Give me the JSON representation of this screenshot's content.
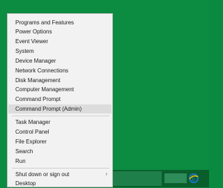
{
  "menu": {
    "items": [
      {
        "label": "Programs and Features"
      },
      {
        "label": "Power Options"
      },
      {
        "label": "Event Viewer"
      },
      {
        "label": "System"
      },
      {
        "label": "Device Manager"
      },
      {
        "label": "Network Connections"
      },
      {
        "label": "Disk Management"
      },
      {
        "label": "Computer Management"
      },
      {
        "label": "Command Prompt"
      },
      {
        "label": "Command Prompt (Admin)"
      },
      {
        "label": "Task Manager"
      },
      {
        "label": "Control Panel"
      },
      {
        "label": "File Explorer"
      },
      {
        "label": "Search"
      },
      {
        "label": "Run"
      },
      {
        "label": "Shut down or sign out"
      },
      {
        "label": "Desktop"
      }
    ],
    "submenu_arrow": "›"
  },
  "taskbar": {
    "icons": [
      "folder-icon",
      "internet-explorer-icon"
    ]
  },
  "colors": {
    "desktop": "#0b8c41",
    "menu_bg": "#f2f2f2",
    "selected_bg": "#dcdcdc",
    "ie_blue": "#1e73c9"
  }
}
